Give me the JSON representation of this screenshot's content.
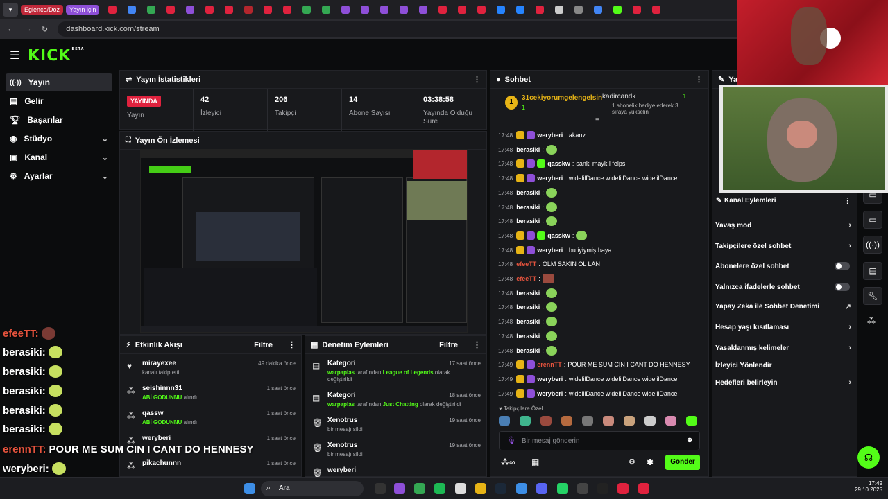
{
  "browser": {
    "tab_pills": [
      "Eglence/Doz",
      "Yayın için"
    ],
    "url": "dashboard.kick.com/stream"
  },
  "brand": {
    "logo": "KICK",
    "logo_sup": "BETA"
  },
  "sidebar": {
    "items": [
      {
        "label": "Yayın",
        "icon": "stream-icon"
      },
      {
        "label": "Gelir",
        "icon": "revenue-icon"
      },
      {
        "label": "Başarılar",
        "icon": "trophy-icon"
      },
      {
        "label": "Stüdyo",
        "icon": "studio-icon"
      },
      {
        "label": "Kanal",
        "icon": "channel-icon"
      },
      {
        "label": "Ayarlar",
        "icon": "gear-icon"
      }
    ]
  },
  "stats": {
    "title": "Yayın İstatistikleri",
    "live_badge": "YAYINDA",
    "cells": [
      {
        "label": "Yayın"
      },
      {
        "value": "42",
        "label": "İzleyici"
      },
      {
        "value": "206",
        "label": "Takipçi"
      },
      {
        "value": "14",
        "label": "Abone Sayısı"
      },
      {
        "value": "03:38:58",
        "label": "Yayında Olduğu Süre"
      }
    ]
  },
  "preview": {
    "title": "Yayın Ön İzlemesi"
  },
  "activity": {
    "title": "Etkinlik Akışı",
    "filter": "Filtre",
    "items": [
      {
        "name": "mirayexee",
        "sub": "kanalı takip etti",
        "time": "49 dakika önce",
        "icon": "heart-icon"
      },
      {
        "name": "seishinnn31",
        "sub_hl": "ABİ GODUNNU",
        "sub": " alındı",
        "time": "1 saat önce",
        "icon": "points-icon"
      },
      {
        "name": "qassw",
        "sub_hl": "ABİ GODUNNU",
        "sub": " alındı",
        "time": "1 saat önce",
        "icon": "points-icon"
      },
      {
        "name": "weryberi",
        "sub_hl": "",
        "sub": "",
        "time": "1 saat önce",
        "icon": "points-icon"
      },
      {
        "name": "pikachunnn",
        "sub_hl": "",
        "sub": "",
        "time": "1 saat önce",
        "icon": "points-icon"
      }
    ]
  },
  "moderation": {
    "title": "Denetim Eylemleri",
    "filter": "Filtre",
    "items": [
      {
        "name": "Kategori",
        "who": "warpaplas",
        "mid": " tarafından ",
        "hl": "League of Legends",
        "tail": "  olarak değiştirildi",
        "time": "17 saat önce",
        "icon": "category-icon"
      },
      {
        "name": "Kategori",
        "who": "warpaplas",
        "mid": " tarafından ",
        "hl": "Just Chatting",
        "tail": " olarak değiştirildi",
        "time": "18 saat önce",
        "icon": "category-icon"
      },
      {
        "name": "Xenotrus",
        "who": "",
        "mid": "",
        "hl": "",
        "tail": "bir mesajı sildi",
        "time": "19 saat önce",
        "icon": "trash-icon"
      },
      {
        "name": "Xenotrus",
        "who": "",
        "mid": "",
        "hl": "",
        "tail": "bir mesajı sildi",
        "time": "19 saat önce",
        "icon": "trash-icon"
      },
      {
        "name": "weryberi",
        "who": "",
        "mid": "",
        "hl": "",
        "tail": "",
        "time": "",
        "icon": "trash-icon"
      }
    ]
  },
  "chat": {
    "title": "Sohbet",
    "pinned_user": "31cekiyorumgelengelsin",
    "pinned_count": "1",
    "gift_user": "kadircandk",
    "gift_count": "1",
    "gift_text": "1 abonelik hediye ederek 3. sıraya yükselin",
    "messages": [
      {
        "time": "17:48",
        "user": "weryberi",
        "color": "#ffffff",
        "text": "akarız"
      },
      {
        "time": "17:48",
        "user": "berasiki",
        "color": "#ffffff",
        "text": ""
      },
      {
        "time": "17:48",
        "user": "qasskw",
        "color": "#ffffff",
        "text": "sanki maykıl felps"
      },
      {
        "time": "17:48",
        "user": "weryberi",
        "color": "#ffffff",
        "text": "widelilDance widelilDance widelilDance"
      },
      {
        "time": "17:48",
        "user": "berasiki",
        "color": "#ffffff",
        "text": ""
      },
      {
        "time": "17:48",
        "user": "berasiki",
        "color": "#ffffff",
        "text": ""
      },
      {
        "time": "17:48",
        "user": "berasiki",
        "color": "#ffffff",
        "text": ""
      },
      {
        "time": "17:48",
        "user": "qasskw",
        "color": "#ffffff",
        "text": ""
      },
      {
        "time": "17:48",
        "user": "weryberi",
        "color": "#ffffff",
        "text": "bu iyiymiş baya"
      },
      {
        "time": "17:48",
        "user": "efeeTT",
        "color": "#e5533d",
        "text": "OLM SAKİN OL LAN"
      },
      {
        "time": "17:48",
        "user": "efeeTT",
        "color": "#e5533d",
        "text": ""
      },
      {
        "time": "17:48",
        "user": "berasiki",
        "color": "#ffffff",
        "text": ""
      },
      {
        "time": "17:48",
        "user": "berasiki",
        "color": "#ffffff",
        "text": ""
      },
      {
        "time": "17:48",
        "user": "berasiki",
        "color": "#ffffff",
        "text": ""
      },
      {
        "time": "17:48",
        "user": "berasiki",
        "color": "#ffffff",
        "text": ""
      },
      {
        "time": "17:48",
        "user": "berasiki",
        "color": "#ffffff",
        "text": ""
      },
      {
        "time": "17:49",
        "user": "erennTT",
        "color": "#e5533d",
        "text": "POUR ME SUM CIN I CANT DO HENNESY"
      },
      {
        "time": "17:49",
        "user": "weryberi",
        "color": "#ffffff",
        "text": "widelilDance widelilDance widelilDance"
      },
      {
        "time": "17:49",
        "user": "weryberi",
        "color": "#ffffff",
        "text": "widelilDance widelilDance widelilDance"
      }
    ],
    "followers_only": "Takipçilere Özel",
    "input_placeholder": "Bir mesaj gönderin",
    "send": "Gönder"
  },
  "channel_actions": {
    "title": "Kanal Eylemleri",
    "items": [
      {
        "label": "Yavaş mod",
        "kind": "chevron"
      },
      {
        "label": "Takipçilere özel sohbet",
        "kind": "chevron"
      },
      {
        "label": "Abonelere özel sohbet",
        "kind": "toggle"
      },
      {
        "label": "Yalnızca ifadelerle sohbet",
        "kind": "toggle"
      },
      {
        "label": "Yapay Zeka ile Sohbet Denetimi",
        "kind": "external"
      },
      {
        "label": "Hesap yaşı kısıtlaması",
        "kind": "chevron"
      },
      {
        "label": "Yasaklanmış kelimeler",
        "kind": "chevron"
      },
      {
        "label": "İzleyici Yönlendir",
        "kind": "none"
      },
      {
        "label": "Hedefleri belirleyin",
        "kind": "chevron"
      }
    ]
  },
  "overlay": {
    "lines": [
      {
        "user": "efeeTT:",
        "color": "#e5533d",
        "text": ""
      },
      {
        "user": "berasiki:",
        "color": "#ffffff",
        "text": ""
      },
      {
        "user": "berasiki:",
        "color": "#ffffff",
        "text": ""
      },
      {
        "user": "berasiki:",
        "color": "#ffffff",
        "text": ""
      },
      {
        "user": "berasiki:",
        "color": "#ffffff",
        "text": ""
      },
      {
        "user": "berasiki:",
        "color": "#ffffff",
        "text": ""
      },
      {
        "user": "erennTT:",
        "color": "#e5533d",
        "text": "POUR ME SUM CIN I CANT DO HENNESY"
      },
      {
        "user": "weryberi:",
        "color": "#ffffff",
        "text": ""
      },
      {
        "user": "weryberi:",
        "color": "#ffffff",
        "text": ""
      }
    ]
  },
  "taskbar": {
    "search": "Ara",
    "time": "17:49",
    "date": "29.10.2025"
  },
  "colors": {
    "accent": "#53fc18",
    "live": "#e0223e",
    "panel": "#18191c"
  }
}
